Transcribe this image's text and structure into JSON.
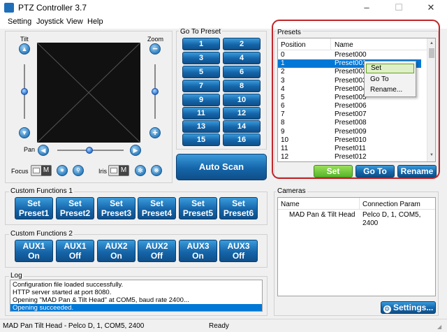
{
  "window": {
    "title": "PTZ Controller 3.7",
    "minimize": "–",
    "maximize": "☐",
    "close": "✕"
  },
  "menu": [
    "Setting",
    "Joystick",
    "View",
    "Help"
  ],
  "joystick": {
    "tilt_label": "Tilt",
    "zoom_label": "Zoom",
    "pan_label": "Pan",
    "focus_label": "Focus",
    "iris_label": "Iris",
    "toggle_glyph": "M",
    "up_glyph": "▲",
    "down_glyph": "▼",
    "left_glyph": "◀",
    "right_glyph": "▶",
    "zoom_in_glyph": "+",
    "zoom_out_glyph": "−"
  },
  "goto_preset": {
    "label": "Go To Preset",
    "buttons": [
      "1",
      "2",
      "3",
      "4",
      "5",
      "6",
      "7",
      "8",
      "9",
      "10",
      "11",
      "12",
      "13",
      "14",
      "15",
      "16"
    ]
  },
  "auto_scan_label": "Auto Scan",
  "custom1": {
    "label": "Custom Functions 1",
    "buttons": [
      [
        "Set",
        "Preset1"
      ],
      [
        "Set",
        "Preset2"
      ],
      [
        "Set",
        "Preset3"
      ],
      [
        "Set",
        "Preset4"
      ],
      [
        "Set",
        "Preset5"
      ],
      [
        "Set",
        "Preset6"
      ]
    ]
  },
  "custom2": {
    "label": "Custom Functions 2",
    "buttons": [
      [
        "AUX1",
        "On"
      ],
      [
        "AUX1",
        "Off"
      ],
      [
        "AUX2",
        "On"
      ],
      [
        "AUX2",
        "Off"
      ],
      [
        "AUX3",
        "On"
      ],
      [
        "AUX3",
        "Off"
      ]
    ]
  },
  "presets": {
    "label": "Presets",
    "columns": [
      "Position",
      "Name"
    ],
    "rows": [
      [
        "0",
        "Preset000"
      ],
      [
        "1",
        "Preset001"
      ],
      [
        "2",
        "Preset002"
      ],
      [
        "3",
        "Preset003"
      ],
      [
        "4",
        "Preset004"
      ],
      [
        "5",
        "Preset005"
      ],
      [
        "6",
        "Preset006"
      ],
      [
        "7",
        "Preset007"
      ],
      [
        "8",
        "Preset008"
      ],
      [
        "9",
        "Preset009"
      ],
      [
        "10",
        "Preset010"
      ],
      [
        "11",
        "Preset011"
      ],
      [
        "12",
        "Preset012"
      ]
    ],
    "selected_index": 1,
    "set_label": "Set",
    "goto_label": "Go To",
    "rename_label": "Rename"
  },
  "context_menu": [
    "Set",
    "Go To",
    "Rename..."
  ],
  "cameras": {
    "label": "Cameras",
    "columns": [
      "Name",
      "Connection Param"
    ],
    "rows": [
      [
        "MAD Pan & Tilt Head",
        "Pelco D, 1, COM5, 2400"
      ]
    ]
  },
  "log": {
    "label": "Log",
    "lines": [
      "Configuration file loaded successfully.",
      "HTTP server started at port 8080.",
      "Opening \"MAD Pan & Tilt Head\" at COM5, baud rate 2400...",
      "Opening succeeded."
    ],
    "selected_index": 3
  },
  "settings_label": "Settings...",
  "status": {
    "camera": "MAD Pan  Tilt Head - Pelco D, 1, COM5, 2400",
    "state": "Ready"
  },
  "colors": {
    "accent_blue": "#1565a9",
    "selection": "#0078d7",
    "highlight_ring": "#c0262a",
    "set_green": "#6cc23a"
  }
}
